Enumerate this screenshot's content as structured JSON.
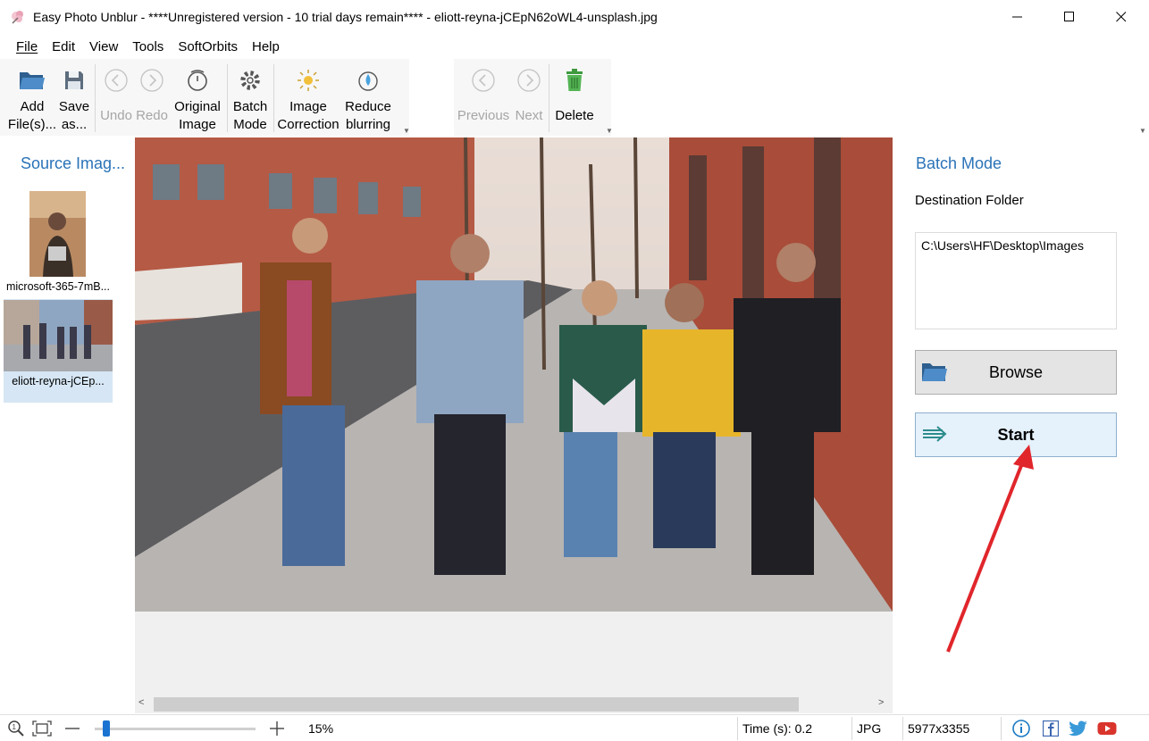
{
  "window": {
    "title": "Easy Photo Unblur - ****Unregistered version - 10 trial days remain**** - eliott-reyna-jCEpN62oWL4-unsplash.jpg"
  },
  "menu": [
    "File",
    "Edit",
    "View",
    "Tools",
    "SoftOrbits",
    "Help"
  ],
  "toolbar": {
    "add_files": "Add\nFile(s)...",
    "save_as": "Save\nas...",
    "undo": "Undo",
    "redo": "Redo",
    "original_image": "Original\nImage",
    "batch_mode": "Batch\nMode",
    "image_correction": "Image\nCorrection",
    "reduce_blurring": "Reduce\nblurring",
    "previous": "Previous",
    "next": "Next",
    "delete": "Delete"
  },
  "left_panel": {
    "title": "Source Imag...",
    "thumbnails": [
      {
        "caption": "microsoft-365-7mB...",
        "selected": false
      },
      {
        "caption": "eliott-reyna-jCEp...",
        "selected": true
      }
    ]
  },
  "right_panel": {
    "title": "Batch Mode",
    "destination_label": "Destination Folder",
    "destination_value": "C:\\Users\\HF\\Desktop\\Images",
    "browse_label": "Browse",
    "start_label": "Start"
  },
  "statusbar": {
    "zoom": "15%",
    "zoom_fraction": 0.05,
    "time": "Time (s): 0.2",
    "format": "JPG",
    "dimensions": "5977x3355"
  },
  "colors": {
    "accent": "#2a73b8",
    "annotation_arrow": "#e0262b",
    "start_bg": "#e5f1fb"
  }
}
